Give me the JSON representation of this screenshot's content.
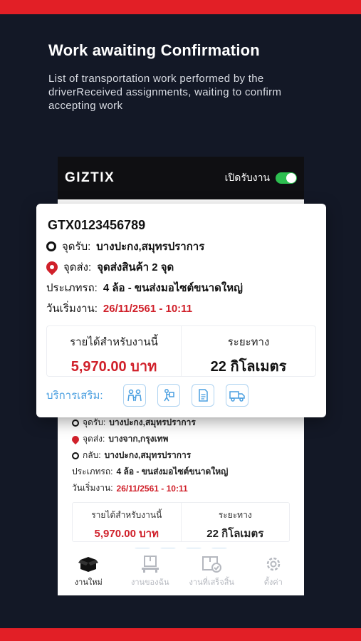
{
  "headline": "Work awaiting Confirmation",
  "description": "List of transportation work performed by the driverReceived assignments, waiting to confirm accepting work",
  "app": {
    "logo": "GIZTIX",
    "toggle_label": "เปิดรับงาน",
    "toggle_on": true
  },
  "job_card": {
    "job_id": "GTX0123456789",
    "pickup_label": "จุดรับ:",
    "pickup_value": "บางปะกง,สมุทรปราการ",
    "dropoff_label": "จุดส่ง:",
    "dropoff_value": "จุดส่งสินค้า 2 จุด",
    "vehicle_label": "ประเภทรถ:",
    "vehicle_value": "4 ล้อ - ขนส่งมอไซต์ขนาดใหญ่",
    "start_label": "วันเริ่มงาน:",
    "start_value": "26/11/2561 - 10:11",
    "income_label": "รายได้สำหรับงานนี้",
    "income_value": "5,970.00 บาท",
    "distance_label": "ระยะทาง",
    "distance_value": "22 กิโลเมตร",
    "extras_label": "บริการเสริม:",
    "extras_icons": [
      "workers-icon",
      "porter-icon",
      "document-icon",
      "truck-icon"
    ]
  },
  "list_item": {
    "pickup_label": "จุดรับ:",
    "pickup_value": "บางปะกง,สมุทรปราการ",
    "dropoff_label": "จุดส่ง:",
    "dropoff_value": "บางจาก,กรุงเทพ",
    "return_label": "กลับ:",
    "return_value": "บางปะกง,สมุทรปราการ",
    "vehicle_label": "ประเภทรถ:",
    "vehicle_value": "4 ล้อ - ขนส่งมอไซต์ขนาดใหญ่",
    "start_label": "วันเริ่มงาน:",
    "start_value": "26/11/2561 - 10:11",
    "income_label": "รายได้สำหรับงานนี้",
    "income_value": "5,970.00 บาท",
    "distance_label": "ระยะทาง",
    "distance_value": "22 กิโลเมตร"
  },
  "tabs": [
    {
      "label": "งานใหม่",
      "icon": "box-icon",
      "active": true
    },
    {
      "label": "งานของฉัน",
      "icon": "pallet-icon",
      "active": false
    },
    {
      "label": "งานที่เสร็จสิ้น",
      "icon": "box-check-icon",
      "active": false
    },
    {
      "label": "ตั้งค่า",
      "icon": "gear-icon",
      "active": false
    }
  ],
  "colors": {
    "background": "#131826",
    "accent_red": "#e21f26",
    "price_red": "#d0202a",
    "toggle_green": "#2dbf50",
    "extras_blue": "#4a9fe0"
  }
}
